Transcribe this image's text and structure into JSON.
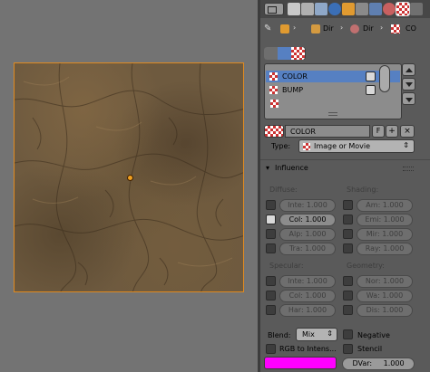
{
  "viewport": {
    "pivot_color": "#f0a020",
    "frame_color": "#e08a20"
  },
  "context_bar": {
    "icons": [
      "pin-icon",
      "object-icon",
      "cube-icon",
      "dir-light-icon",
      "texture-icon"
    ],
    "crumbs": [
      {
        "label": "Dir"
      },
      {
        "label": "Dir"
      },
      {
        "label": "CO"
      }
    ]
  },
  "texture_slots": {
    "items": [
      {
        "name": "COLOR",
        "enabled": true,
        "selected": true
      },
      {
        "name": "BUMP",
        "enabled": true,
        "selected": false
      }
    ]
  },
  "texture_block": {
    "name": "COLOR",
    "fake_user": "F",
    "type_label": "Type:",
    "type_value": "Image or Movie"
  },
  "influence": {
    "title": "Influence",
    "diffuse_label": "Diffuse:",
    "shading_label": "Shading:",
    "specular_label": "Specular:",
    "geometry_label": "Geometry:",
    "diffuse": [
      {
        "label": "Inte: 1.000",
        "on": false
      },
      {
        "label": "Col:  1.000",
        "on": true
      },
      {
        "label": "Alp:  1.000",
        "on": false
      },
      {
        "label": "Tra:  1.000",
        "on": false
      }
    ],
    "shading": [
      {
        "label": "Am:  1.000",
        "on": false
      },
      {
        "label": "Emi: 1.000",
        "on": false
      },
      {
        "label": "Mir: 1.000",
        "on": false
      },
      {
        "label": "Ray: 1.000",
        "on": false
      }
    ],
    "specular": [
      {
        "label": "Inte: 1.000",
        "on": false
      },
      {
        "label": "Col:  1.000",
        "on": false
      },
      {
        "label": "Har:  1.000",
        "on": false
      }
    ],
    "geometry": [
      {
        "label": "Nor:  1.000",
        "on": false
      },
      {
        "label": "Wa:  1.000",
        "on": false
      },
      {
        "label": "Dis:  1.000",
        "on": false
      }
    ],
    "blend_label": "Blend:",
    "blend_value": "Mix",
    "negative_label": "Negative",
    "rgb_to_intensity_label": "RGB to Intens...",
    "stencil_label": "Stencil",
    "color_swatch": "#ff00ff",
    "dvar_label": "DVar:",
    "dvar_value": "1.000"
  }
}
